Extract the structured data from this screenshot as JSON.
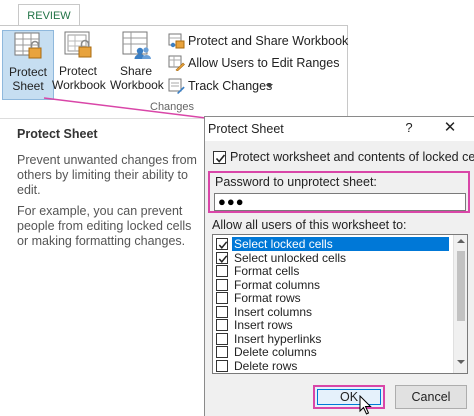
{
  "ribbon": {
    "tab": "REVIEW",
    "buttons": {
      "protect_sheet": [
        "Protect",
        "Sheet"
      ],
      "protect_workbook": [
        "Protect",
        "Workbook"
      ],
      "share_workbook": [
        "Share",
        "Workbook"
      ]
    },
    "small_buttons": {
      "protect_share": "Protect and Share Workbook",
      "allow_users": "Allow Users to Edit Ranges",
      "track_changes": "Track Changes"
    },
    "group_label": "Changes"
  },
  "tooltip": {
    "title": "Protect Sheet",
    "paragraph1": "Prevent unwanted changes from others by limiting their ability to edit.",
    "paragraph2": "For example, you can prevent people from editing locked cells or making formatting changes."
  },
  "dialog": {
    "title": "Protect Sheet",
    "help": "?",
    "close": "✕",
    "protect_checkbox_label": "Protect worksheet and contents of locked cells",
    "protect_checked": true,
    "password_label": "Password to unprotect sheet:",
    "password_value": "●●●",
    "allow_label": "Allow all users of this worksheet to:",
    "permissions": [
      {
        "label": "Select locked cells",
        "checked": true,
        "selected": true
      },
      {
        "label": "Select unlocked cells",
        "checked": true,
        "selected": false
      },
      {
        "label": "Format cells",
        "checked": false,
        "selected": false
      },
      {
        "label": "Format columns",
        "checked": false,
        "selected": false
      },
      {
        "label": "Format rows",
        "checked": false,
        "selected": false
      },
      {
        "label": "Insert columns",
        "checked": false,
        "selected": false
      },
      {
        "label": "Insert rows",
        "checked": false,
        "selected": false
      },
      {
        "label": "Insert hyperlinks",
        "checked": false,
        "selected": false
      },
      {
        "label": "Delete columns",
        "checked": false,
        "selected": false
      },
      {
        "label": "Delete rows",
        "checked": false,
        "selected": false
      }
    ],
    "ok_label": "OK",
    "cancel_label": "Cancel"
  },
  "colors": {
    "accent": "#d946a8",
    "selection": "#0078d7",
    "review_tab": "#217346"
  }
}
